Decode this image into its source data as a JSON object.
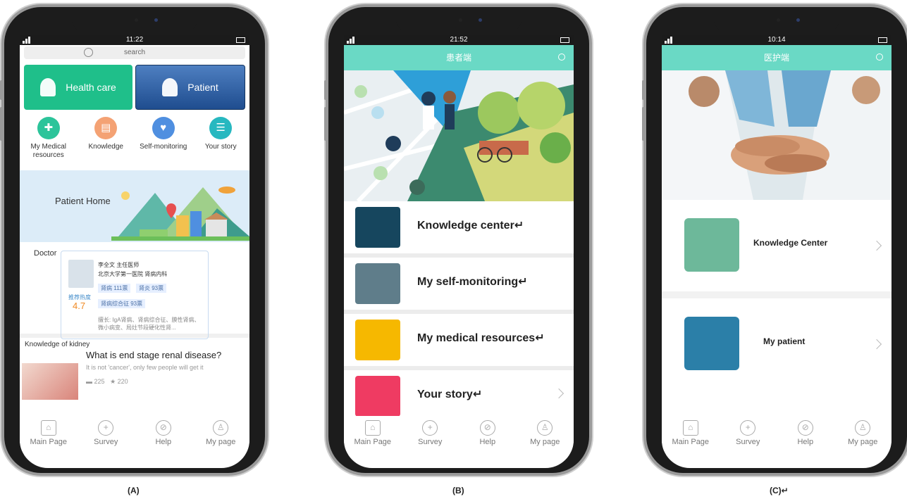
{
  "phone_a": {
    "time": "11:22",
    "search_placeholder": "search",
    "roles": [
      "Health care",
      "Patient"
    ],
    "features": [
      {
        "label": "My Medical resources",
        "color": "#2cc49a"
      },
      {
        "label": "Knowledge",
        "color": "#f4a274"
      },
      {
        "label": "Self-monitoring",
        "color": "#4f8fe0"
      },
      {
        "label": "Your story",
        "color": "#27b8c0"
      }
    ],
    "banner_title": "Patient Home",
    "doctor": {
      "section_label": "Doctor",
      "name_title": "李全文 主任医师",
      "hospital": "北京大学第一医院 肾病内科",
      "tags": [
        "肾病 111票",
        "肾炎 93票",
        "肾病综合征 93票"
      ],
      "heat_label": "推荐热度",
      "score": "4.7",
      "specialty": "擅长: IgA肾病、肾病综合征、膜性肾病、微小病变、局灶节段硬化性肾..."
    },
    "knowledge": {
      "header": "Knowledge of kidney",
      "title": "What is end stage renal disease?",
      "subtitle": "It is not 'cancer', only few people will get it",
      "comments": "225",
      "stars": "220"
    }
  },
  "phone_b": {
    "time": "21:52",
    "title": "患者端",
    "items": [
      "Knowledge center↵",
      "My self-monitoring↵",
      "My medical resources↵",
      "Your story↵"
    ],
    "item_colors": [
      "#16465e",
      "#5f7d8a",
      "#f6b800",
      "#ef3b62"
    ]
  },
  "phone_c": {
    "time": "10:14",
    "title": "医护端",
    "items": [
      "Knowledge Center",
      "My patient"
    ],
    "item_colors": [
      "#6db89a",
      "#2b7fa8"
    ]
  },
  "bottom_nav": [
    "Main Page",
    "Survey",
    "Help",
    "My page"
  ],
  "captions": [
    "(A)",
    "(B)",
    "(C)↵"
  ]
}
